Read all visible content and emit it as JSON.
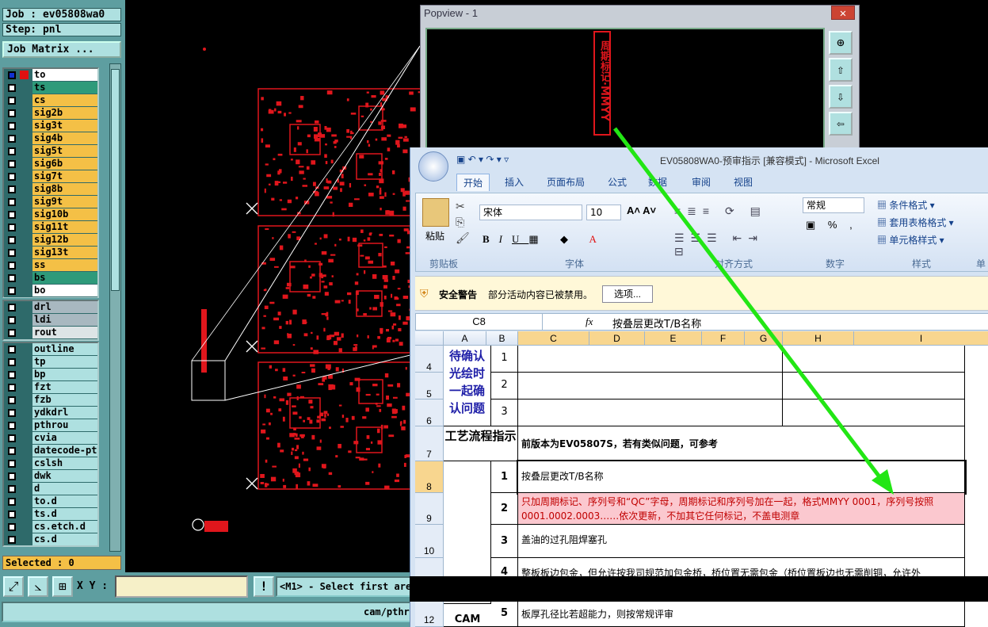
{
  "cam": {
    "job": "Job : ev05808wa0",
    "step": "Step: pnl",
    "job_matrix": "Job Matrix ...",
    "layers_group1": [
      {
        "name": "to",
        "color": "#ffffff"
      },
      {
        "name": "ts",
        "color": "#2e9a7a"
      },
      {
        "name": "cs",
        "color": "#f4c046"
      },
      {
        "name": "sig2b",
        "color": "#f4c046"
      },
      {
        "name": "sig3t",
        "color": "#f4c046"
      },
      {
        "name": "sig4b",
        "color": "#f4c046"
      },
      {
        "name": "sig5t",
        "color": "#f4c046"
      },
      {
        "name": "sig6b",
        "color": "#f4c046"
      },
      {
        "name": "sig7t",
        "color": "#f4c046"
      },
      {
        "name": "sig8b",
        "color": "#f4c046"
      },
      {
        "name": "sig9t",
        "color": "#f4c046"
      },
      {
        "name": "sig10b",
        "color": "#f4c046"
      },
      {
        "name": "sig11t",
        "color": "#f4c046"
      },
      {
        "name": "sig12b",
        "color": "#f4c046"
      },
      {
        "name": "sig13t",
        "color": "#f4c046"
      },
      {
        "name": "ss",
        "color": "#f4c046"
      },
      {
        "name": "bs",
        "color": "#2e9a7a"
      },
      {
        "name": "bo",
        "color": "#ffffff"
      }
    ],
    "layers_group2": [
      {
        "name": "drl",
        "color": "#a8b8c0"
      },
      {
        "name": "ldi",
        "color": "#a8b8c0"
      },
      {
        "name": "rout",
        "color": "#dde4e6"
      }
    ],
    "layers_group3": [
      {
        "name": "outline",
        "color": "#aee0e0"
      },
      {
        "name": "tp",
        "color": "#aee0e0"
      },
      {
        "name": "bp",
        "color": "#aee0e0"
      },
      {
        "name": "fzt",
        "color": "#aee0e0"
      },
      {
        "name": "fzb",
        "color": "#aee0e0"
      },
      {
        "name": "ydkdrl",
        "color": "#aee0e0"
      },
      {
        "name": "pthrou",
        "color": "#aee0e0"
      },
      {
        "name": "cvia",
        "color": "#aee0e0"
      },
      {
        "name": "datecode-pto",
        "color": "#aee0e0"
      },
      {
        "name": "cslsh",
        "color": "#aee0e0"
      },
      {
        "name": "dwk",
        "color": "#aee0e0"
      },
      {
        "name": "d",
        "color": "#aee0e0"
      },
      {
        "name": "to.d",
        "color": "#aee0e0"
      },
      {
        "name": "ts.d",
        "color": "#aee0e0"
      },
      {
        "name": "cs.etch.d",
        "color": "#aee0e0"
      },
      {
        "name": "cs.d",
        "color": "#aee0e0"
      }
    ],
    "selected": "Selected : 0",
    "xy_label": "X Y :",
    "xy_value": "",
    "status_msg": "<M1> - Select first area",
    "path": "cam/pthro",
    "canvas_bg": "#000000",
    "pcb_color": "#e0161c"
  },
  "popview": {
    "title": "Popview - 1",
    "close": "✕",
    "vertical_text": "周期标记·MMYY"
  },
  "excel": {
    "title": "EV05808WA0-预审指示 [兼容模式] - Microsoft Excel",
    "tabs": [
      "开始",
      "插入",
      "页面布局",
      "公式",
      "数据",
      "审阅",
      "视图"
    ],
    "font_name": "宋体",
    "font_size": "10",
    "number_format": "常规",
    "paste": "粘贴",
    "groups": [
      "剪贴板",
      "字体",
      "对齐方式",
      "数字",
      "样式",
      "单"
    ],
    "style_items": [
      "条件格式",
      "套用表格格式",
      "单元格样式"
    ],
    "security_title": "安全警告",
    "security_msg": "部分活动内容已被禁用。",
    "options_btn": "选项...",
    "name_box": "C8",
    "fx": "fx",
    "formula": "按叠层更改T/B名称",
    "col_headers": [
      "A",
      "B",
      "C",
      "D",
      "E",
      "F",
      "G",
      "H",
      "I"
    ],
    "row_headers": [
      "4",
      "5",
      "6",
      "7",
      "8",
      "9",
      "10",
      "11",
      "12"
    ],
    "confirm_label": "待确认光绘时一起确认问题",
    "seq_456": [
      "1",
      "2",
      "3"
    ],
    "process_label": "工艺流程指示",
    "process_note": "前版本为EV05807S，若有类似问题，可参考",
    "items": [
      {
        "n": "1",
        "text": "按叠层更改T/B名称"
      },
      {
        "n": "2",
        "text": "只加周期标记、序列号和“QC”字母，周期标记和序列号加在一起，格式MMYY 0001，序列号按照0001.0002.0003……依次更新，不加其它任何标记，不盖电测章"
      },
      {
        "n": "3",
        "text": "盖油的过孔阻焊塞孔"
      },
      {
        "n": "4",
        "text": "整板板边包金，但允许按我司规范加包金桥，桥位置无需包金（桥位置板边也无需削铜，允许外"
      },
      {
        "n": "5",
        "text": "板厚孔径比若超能力，则按常规评审"
      }
    ],
    "cam_label": "CAM",
    "pink": "#fbc8cf",
    "red_text": "#c00000",
    "blue_text": "#1f1fa8"
  },
  "arrow_color": "#22e614"
}
